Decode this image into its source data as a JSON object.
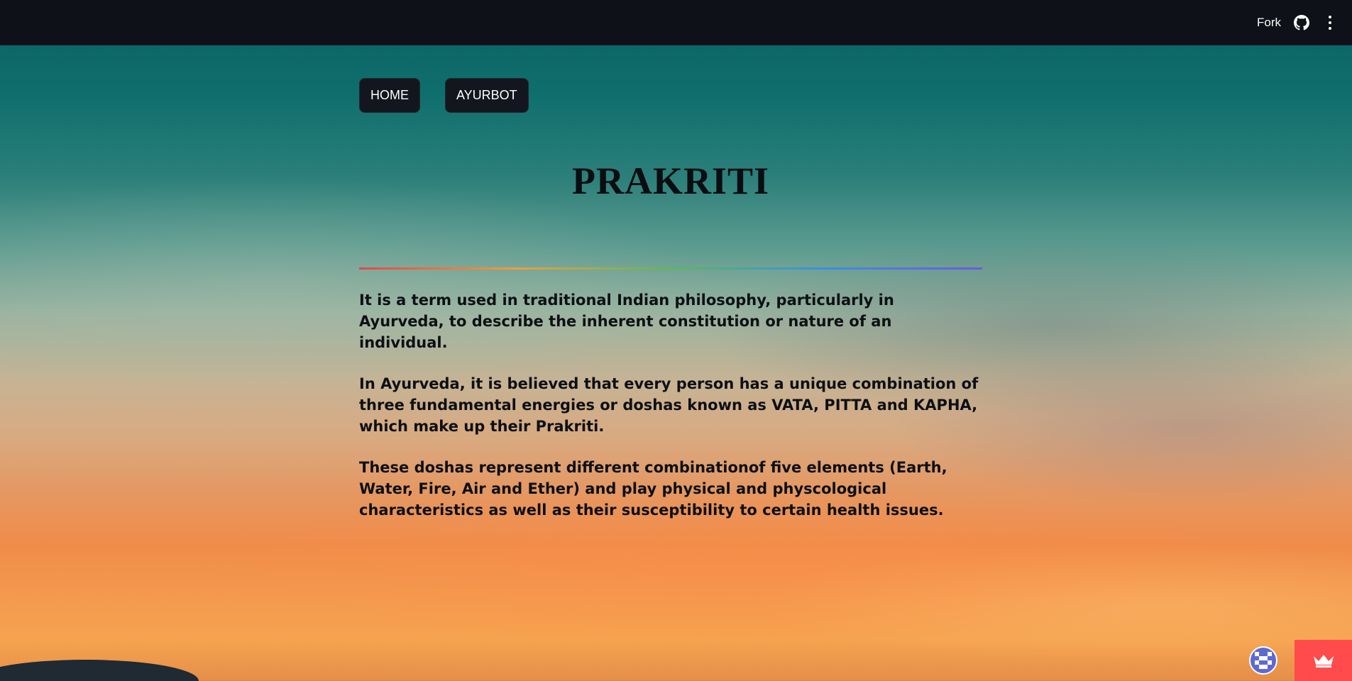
{
  "topbar": {
    "fork_label": "Fork",
    "icons": [
      "github-icon",
      "more-vertical-icon"
    ]
  },
  "nav": {
    "items": [
      {
        "label": "HOME"
      },
      {
        "label": "AYURBOT"
      }
    ]
  },
  "main": {
    "title": "PRAKRITI",
    "paragraphs": [
      "It is a term used in traditional Indian philosophy, particularly in Ayurveda, to describe the inherent constitution or nature of an individual.",
      "In Ayurveda, it is believed that every person has a unique combination of three fundamental energies or doshas known as VATA, PITTA and KAPHA, which make up their Prakriti.",
      "These doshas represent different combinationof five elements (Earth, Water, Fire, Air and Ether) and play physical and physcological characteristics as well as their susceptibility to certain health issues."
    ]
  },
  "colors": {
    "topbar_bg": "#0e1117",
    "nav_button_bg": "#13161f",
    "crown_tab_bg": "#ff4b4b",
    "avatar_bg": "#5d6ad2"
  },
  "footer": {
    "icons": [
      "user-avatar-icon",
      "crown-icon"
    ]
  }
}
